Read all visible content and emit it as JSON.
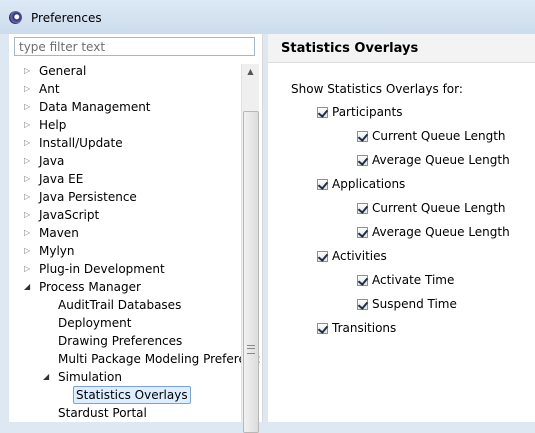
{
  "window": {
    "title": "Preferences"
  },
  "filter": {
    "placeholder": "type filter text"
  },
  "tree": [
    {
      "label": "General",
      "expanded": false
    },
    {
      "label": "Ant",
      "expanded": false
    },
    {
      "label": "Data Management",
      "expanded": false
    },
    {
      "label": "Help",
      "expanded": false
    },
    {
      "label": "Install/Update",
      "expanded": false
    },
    {
      "label": "Java",
      "expanded": false
    },
    {
      "label": "Java EE",
      "expanded": false
    },
    {
      "label": "Java Persistence",
      "expanded": false
    },
    {
      "label": "JavaScript",
      "expanded": false
    },
    {
      "label": "Maven",
      "expanded": false
    },
    {
      "label": "Mylyn",
      "expanded": false
    },
    {
      "label": "Plug-in Development",
      "expanded": false
    },
    {
      "label": "Process Manager",
      "expanded": true
    },
    {
      "label": "AuditTrail Databases"
    },
    {
      "label": "Deployment"
    },
    {
      "label": "Drawing Preferences"
    },
    {
      "label": "Multi Package Modeling Preferenc"
    },
    {
      "label": "Simulation",
      "expanded": true
    },
    {
      "label": "Statistics Overlays",
      "selected": true
    },
    {
      "label": "Stardust Portal"
    }
  ],
  "page": {
    "title": "Statistics Overlays",
    "show_label": "Show Statistics Overlays for:",
    "options": [
      {
        "label": "Participants",
        "checked": true
      },
      {
        "label": "Current Queue Length",
        "checked": true
      },
      {
        "label": "Average Queue Length",
        "checked": true
      },
      {
        "label": "Applications",
        "checked": true
      },
      {
        "label": "Current Queue Length",
        "checked": true
      },
      {
        "label": "Average Queue Length",
        "checked": true
      },
      {
        "label": "Activities",
        "checked": true
      },
      {
        "label": "Activate Time",
        "checked": true
      },
      {
        "label": "Suspend Time",
        "checked": true
      },
      {
        "label": "Transitions",
        "checked": true
      }
    ]
  }
}
